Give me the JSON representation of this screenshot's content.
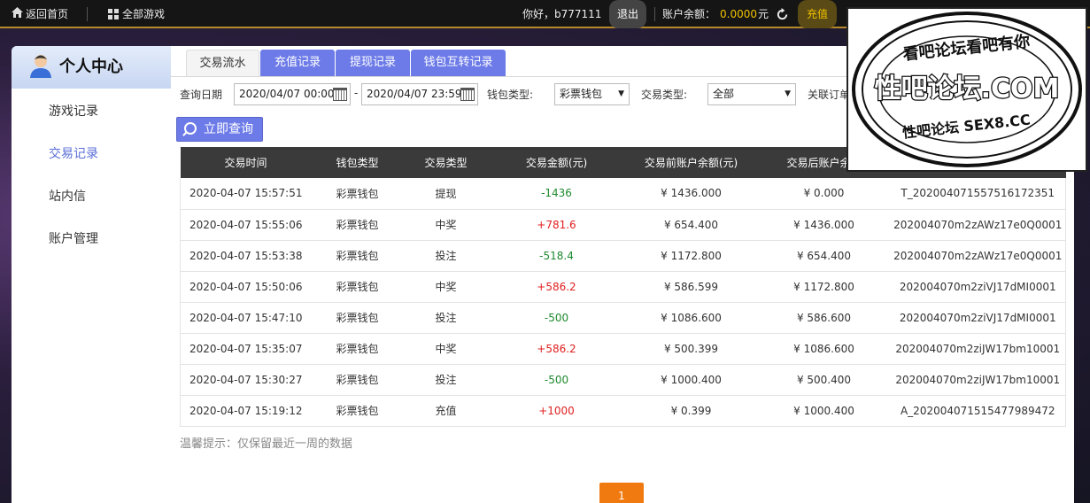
{
  "topbar": {
    "home_label": "返回首页",
    "allgames_label": "全部游戏",
    "greeting": "你好，b777111",
    "logout_label": "退出",
    "balance_label": "账户余额：",
    "balance_value": "0.0000",
    "balance_unit": "元",
    "recharge_label": "充值"
  },
  "sidebar": {
    "title": "个人中心",
    "items": [
      {
        "label": "游戏记录",
        "active": false
      },
      {
        "label": "交易记录",
        "active": true
      },
      {
        "label": "站内信",
        "active": false
      },
      {
        "label": "账户管理",
        "active": false
      }
    ]
  },
  "tabs": [
    {
      "label": "交易流水",
      "active": true
    },
    {
      "label": "充值记录",
      "active": false
    },
    {
      "label": "提现记录",
      "active": false
    },
    {
      "label": "钱包互转记录",
      "active": false
    }
  ],
  "filters": {
    "date_label": "查询日期",
    "date_start": "2020/04/07 00:00",
    "date_sep": "-",
    "date_end": "2020/04/07 23:59",
    "wallet_label": "钱包类型:",
    "wallet_value": "彩票钱包",
    "type_label": "交易类型:",
    "type_value": "全部",
    "order_label": "关联订单"
  },
  "query_label": "立即查询",
  "table": {
    "headers": [
      "交易时间",
      "钱包类型",
      "交易类型",
      "交易金额(元)",
      "交易前账户余额(元)",
      "交易后账户余额",
      ""
    ],
    "rows": [
      [
        "2020-04-07 15:57:51",
        "彩票钱包",
        "提现",
        "-1436",
        "¥ 1436.000",
        "¥ 0.000",
        "T_202004071557516172351"
      ],
      [
        "2020-04-07 15:55:06",
        "彩票钱包",
        "中奖",
        "+781.6",
        "¥ 654.400",
        "¥ 1436.000",
        "202004070m2zAWz17e0Q0001"
      ],
      [
        "2020-04-07 15:53:38",
        "彩票钱包",
        "投注",
        "-518.4",
        "¥ 1172.800",
        "¥ 654.400",
        "202004070m2zAWz17e0Q0001"
      ],
      [
        "2020-04-07 15:50:06",
        "彩票钱包",
        "中奖",
        "+586.2",
        "¥ 586.599",
        "¥ 1172.800",
        "202004070m2ziVJ17dMI0001"
      ],
      [
        "2020-04-07 15:47:10",
        "彩票钱包",
        "投注",
        "-500",
        "¥ 1086.600",
        "¥ 586.600",
        "202004070m2ziVJ17dMI0001"
      ],
      [
        "2020-04-07 15:35:07",
        "彩票钱包",
        "中奖",
        "+586.2",
        "¥ 500.399",
        "¥ 1086.600",
        "202004070m2ziJW17bm10001"
      ],
      [
        "2020-04-07 15:30:27",
        "彩票钱包",
        "投注",
        "-500",
        "¥ 1000.400",
        "¥ 500.400",
        "202004070m2ziJW17bm10001"
      ],
      [
        "2020-04-07 15:19:12",
        "彩票钱包",
        "充值",
        "+1000",
        "¥ 0.399",
        "¥ 1000.400",
        "A_202004071515477989472"
      ]
    ]
  },
  "tip": "温馨提示：仅保留最近一周的数据",
  "pager": {
    "current": "1"
  },
  "watermark": {
    "top_text": "看吧论坛看吧有你",
    "main_text": "性吧论坛.COM",
    "bottom_text": "性吧论坛 SEX8.CC"
  },
  "colors": {
    "accent": "#6d7be8",
    "positive": "#e02020",
    "negative": "#1e8a2e",
    "balance": "#f2c200",
    "pager": "#f07a10"
  }
}
